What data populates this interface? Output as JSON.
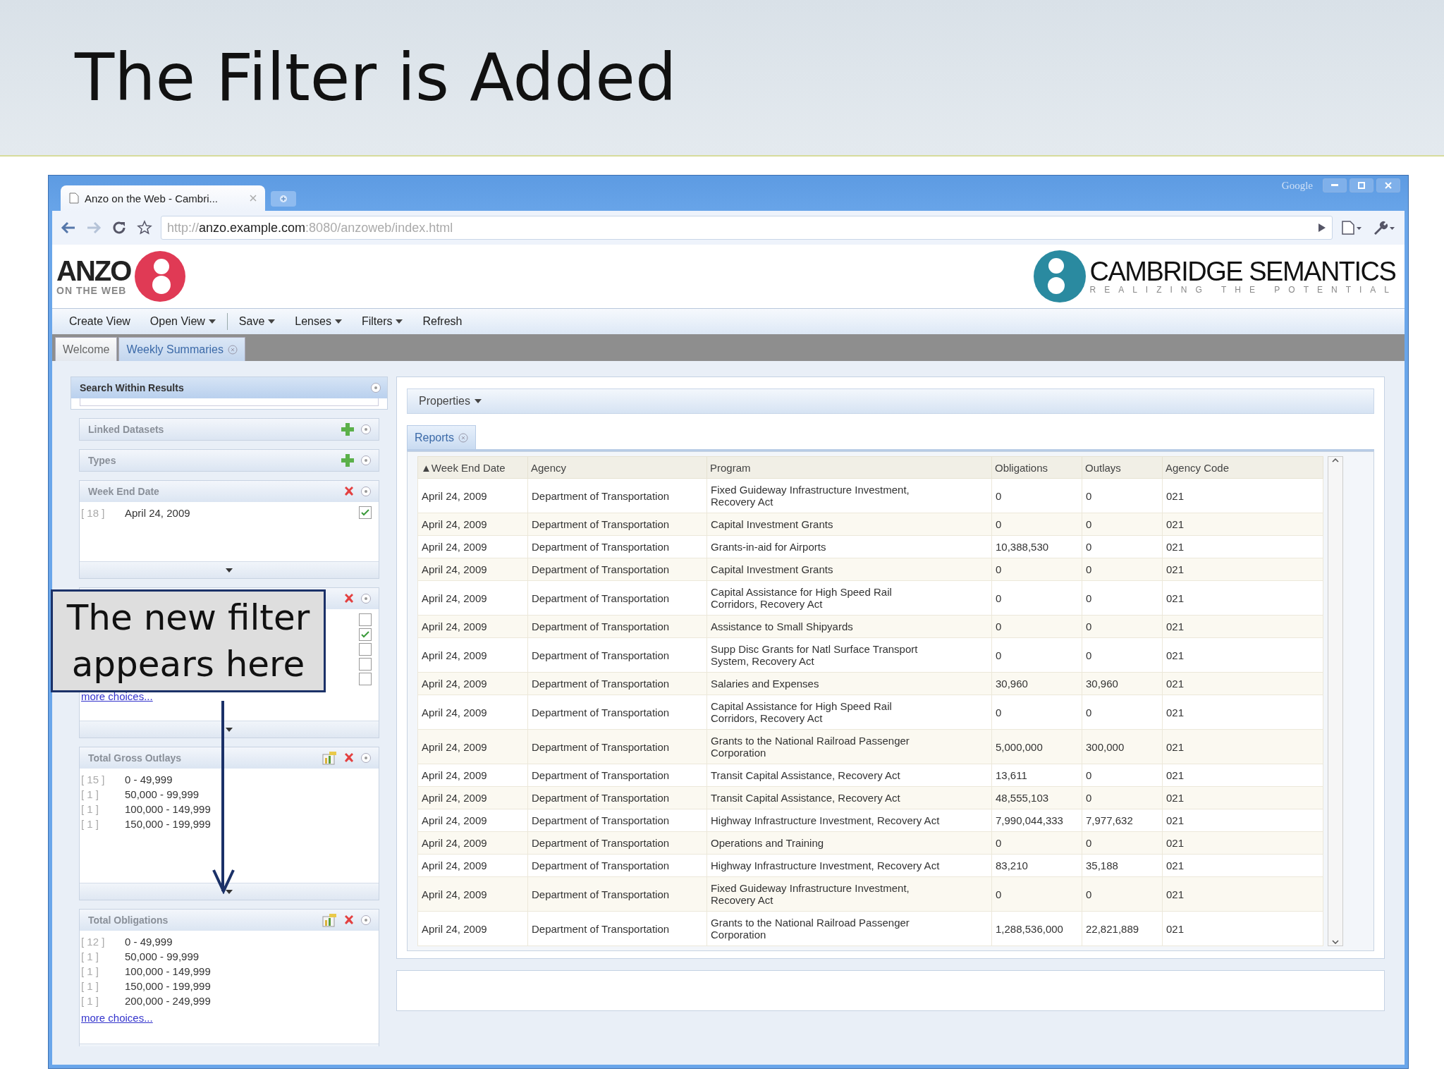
{
  "slide_title": "The Filter is Added",
  "browser": {
    "tab_title": "Anzo on the Web - Cambri...",
    "window_label": "Google",
    "url": {
      "scheme": "http://",
      "host": "anzo.example.com",
      "path": ":8080/anzoweb/index.html"
    }
  },
  "app": {
    "logo": {
      "name": "ANZO",
      "tagline": "ON THE WEB"
    },
    "company_logo": {
      "name": "CAMBRIDGE SEMANTICS",
      "tagline": "REALIZING THE POTENTIAL"
    },
    "menu": [
      {
        "label": "Create View",
        "dropdown": false
      },
      {
        "label": "Open View",
        "dropdown": true
      },
      {
        "label": "Save",
        "dropdown": true
      },
      {
        "label": "Lenses",
        "dropdown": true
      },
      {
        "label": "Filters",
        "dropdown": true
      },
      {
        "label": "Refresh",
        "dropdown": false
      }
    ],
    "tabs": [
      {
        "label": "Welcome",
        "selected": false,
        "closable": false
      },
      {
        "label": "Weekly Summaries",
        "selected": true,
        "closable": true
      }
    ]
  },
  "left_panel": {
    "search_title": "Search Within Results",
    "facets": [
      {
        "kind": "add",
        "title": "Linked Datasets"
      },
      {
        "kind": "add",
        "title": "Types"
      },
      {
        "kind": "list",
        "title": "Week End Date",
        "removable": true,
        "chart": false,
        "items": [
          {
            "count": "[ 18 ]",
            "value": "April 24, 2009",
            "checked": true
          }
        ]
      },
      {
        "kind": "list",
        "removable": true,
        "chart": false,
        "items": [
          {
            "checked": false
          },
          {
            "checked": true
          },
          {
            "checked": false
          },
          {
            "checked": false
          },
          {
            "checked": false
          }
        ],
        "more": "more choices..."
      },
      {
        "kind": "list",
        "title": "Total Gross Outlays",
        "removable": true,
        "chart": true,
        "items": [
          {
            "count": "[ 15 ]",
            "value": "0 - 49,999"
          },
          {
            "count": "[ 1 ]",
            "value": "50,000 - 99,999"
          },
          {
            "count": "[ 1 ]",
            "value": "100,000 - 149,999"
          },
          {
            "count": "[ 1 ]",
            "value": "150,000 - 199,999"
          }
        ]
      },
      {
        "kind": "list",
        "title": "Total Obligations",
        "removable": true,
        "chart": true,
        "items": [
          {
            "count": "[ 12 ]",
            "value": "0 - 49,999"
          },
          {
            "count": "[ 1 ]",
            "value": "50,000 - 99,999"
          },
          {
            "count": "[ 1 ]",
            "value": "100,000 - 149,999"
          },
          {
            "count": "[ 1 ]",
            "value": "150,000 - 199,999"
          },
          {
            "count": "[ 1 ]",
            "value": "200,000 - 249,999"
          }
        ],
        "more": "more choices..."
      }
    ]
  },
  "main": {
    "properties_label": "Properties",
    "tabs": [
      {
        "label": "Reports",
        "selected": true
      }
    ],
    "table": {
      "columns": [
        "▲Week End Date",
        "Agency",
        "Program",
        "Obligations",
        "Outlays",
        "Agency Code"
      ],
      "rows": [
        [
          "April 24, 2009",
          "Department of Transportation",
          "Fixed Guideway Infrastructure Investment,\nRecovery Act",
          "0",
          "0",
          "021"
        ],
        [
          "April 24, 2009",
          "Department of Transportation",
          "Capital Investment Grants",
          "0",
          "0",
          "021"
        ],
        [
          "April 24, 2009",
          "Department of Transportation",
          "Grants-in-aid for Airports",
          "10,388,530",
          "0",
          "021"
        ],
        [
          "April 24, 2009",
          "Department of Transportation",
          "Capital Investment Grants",
          "0",
          "0",
          "021"
        ],
        [
          "April 24, 2009",
          "Department of Transportation",
          "Capital Assistance for High Speed Rail\nCorridors, Recovery Act",
          "0",
          "0",
          "021"
        ],
        [
          "April 24, 2009",
          "Department of Transportation",
          "Assistance to Small Shipyards",
          "0",
          "0",
          "021"
        ],
        [
          "April 24, 2009",
          "Department of Transportation",
          "Supp Disc Grants for Natl Surface Transport\nSystem, Recovery Act",
          "0",
          "0",
          "021"
        ],
        [
          "April 24, 2009",
          "Department of Transportation",
          "Salaries and Expenses",
          "30,960",
          "30,960",
          "021"
        ],
        [
          "April 24, 2009",
          "Department of Transportation",
          "Capital Assistance for High Speed Rail\nCorridors, Recovery Act",
          "0",
          "0",
          "021"
        ],
        [
          "April 24, 2009",
          "Department of Transportation",
          "Grants to the National Railroad Passenger\nCorporation",
          "5,000,000",
          "300,000",
          "021"
        ],
        [
          "April 24, 2009",
          "Department of Transportation",
          "Transit Capital Assistance, Recovery Act",
          "13,611",
          "0",
          "021"
        ],
        [
          "April 24, 2009",
          "Department of Transportation",
          "Transit Capital Assistance, Recovery Act",
          "48,555,103",
          "0",
          "021"
        ],
        [
          "April 24, 2009",
          "Department of Transportation",
          "Highway Infrastructure Investment, Recovery Act",
          "7,990,044,333",
          "7,977,632",
          "021"
        ],
        [
          "April 24, 2009",
          "Department of Transportation",
          "Operations and Training",
          "0",
          "0",
          "021"
        ],
        [
          "April 24, 2009",
          "Department of Transportation",
          "Highway Infrastructure Investment, Recovery Act",
          "83,210",
          "35,188",
          "021"
        ],
        [
          "April 24, 2009",
          "Department of Transportation",
          "Fixed Guideway Infrastructure Investment,\nRecovery Act",
          "0",
          "0",
          "021"
        ],
        [
          "April 24, 2009",
          "Department of Transportation",
          "Grants to the National Railroad Passenger\nCorporation",
          "1,288,536,000",
          "22,821,889",
          "021"
        ]
      ]
    }
  },
  "callout": {
    "text": "The new filter\nappears here"
  }
}
